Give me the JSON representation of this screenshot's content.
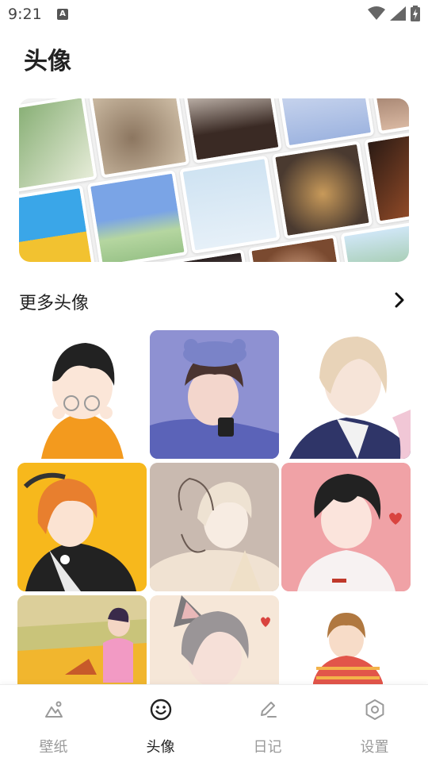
{
  "status_bar": {
    "time": "9:21",
    "notification_icon": "a-icon",
    "wifi_icon": "wifi-icon",
    "signal_icon": "signal-icon",
    "battery_icon": "battery-charging-icon"
  },
  "page": {
    "title": "头像"
  },
  "banner": {
    "description_icon": "avatar-collage"
  },
  "section": {
    "title": "更多头像",
    "more_icon": "chevron-right-icon"
  },
  "avatars": [
    {
      "name": "avatar-boy-glasses-orange"
    },
    {
      "name": "avatar-girl-bear-hat-blue"
    },
    {
      "name": "avatar-blonde-boy-coat"
    },
    {
      "name": "avatar-girl-yellow-bg"
    },
    {
      "name": "avatar-cat-ear-boy-sketch"
    },
    {
      "name": "avatar-black-hair-boy-pink"
    },
    {
      "name": "avatar-boy-field-deer"
    },
    {
      "name": "avatar-gray-cat-ear-boy"
    },
    {
      "name": "avatar-chibi-sweater"
    }
  ],
  "nav": {
    "items": [
      {
        "label": "壁纸",
        "icon": "wallpaper-icon",
        "active": false
      },
      {
        "label": "头像",
        "icon": "smiley-icon",
        "active": true
      },
      {
        "label": "日记",
        "icon": "pencil-icon",
        "active": false
      },
      {
        "label": "设置",
        "icon": "settings-icon",
        "active": false
      }
    ]
  },
  "colors": {
    "active": "#222222",
    "inactive": "#9a9a9a",
    "background": "#ffffff"
  }
}
